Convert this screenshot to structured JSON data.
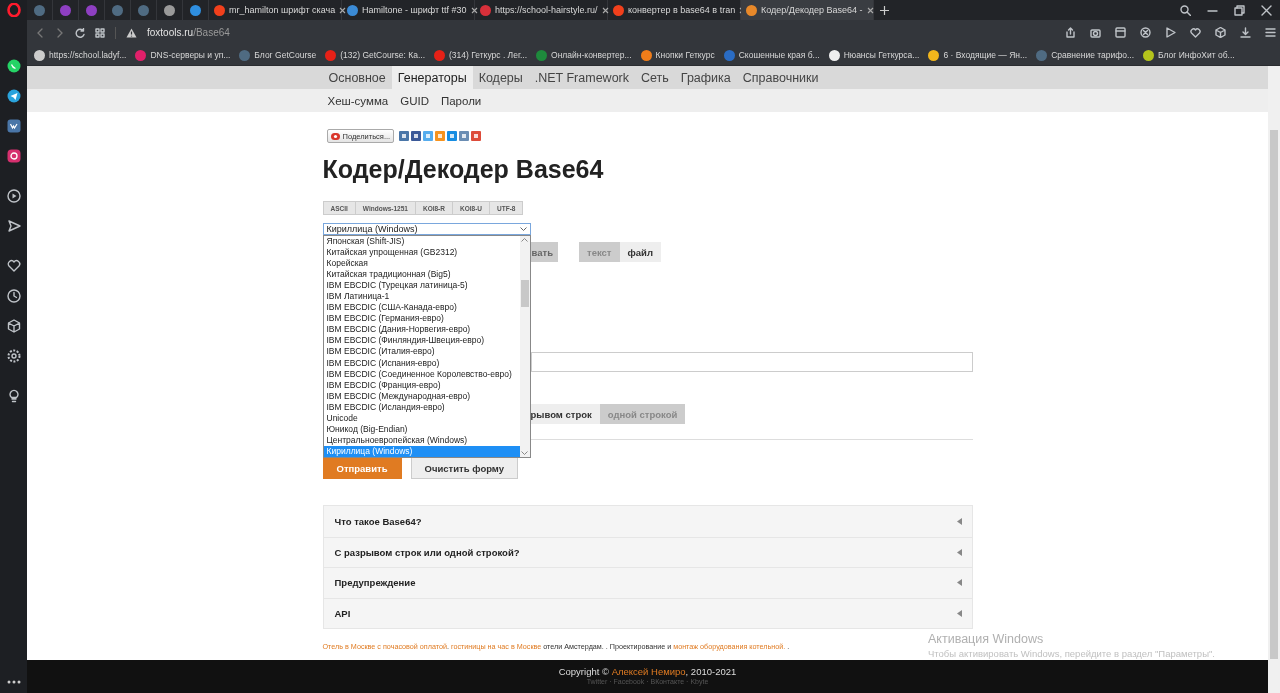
{
  "tabs": [
    {
      "selected": false,
      "color": "#4f6b82"
    },
    {
      "selected": false,
      "color": "#8e3fc2"
    },
    {
      "selected": false,
      "color": "#8e3fc2"
    },
    {
      "selected": false,
      "color": "#4f6b82"
    },
    {
      "selected": false,
      "color": "#4f6b82"
    },
    {
      "selected": false,
      "color": "#9a9a9a"
    },
    {
      "selected": false,
      "color": "#2f8fe0"
    },
    {
      "title": "mr_hamilton шрифт скача",
      "selected": false,
      "color": "#f2401c"
    },
    {
      "title": "Hamiltone - шрифт ttf #30",
      "selected": false,
      "color": "#3b8bd6"
    },
    {
      "title": "https://school-hairstyle.ru/",
      "selected": false,
      "color": "#d8303a"
    },
    {
      "title": "конвертер в base64 в tran",
      "selected": false,
      "color": "#f2401c"
    },
    {
      "title": "Кодер/Декодер Base64 -",
      "selected": true,
      "color": "#e8892a"
    }
  ],
  "address_bar": {
    "domain": "foxtools.ru",
    "path": "/Base64"
  },
  "bookmarks": [
    {
      "label": "https://school.ladyf...",
      "color": "#cccccc"
    },
    {
      "label": "DNS-серверы и уп...",
      "color": "#e0206a"
    },
    {
      "label": "Блог GetCourse",
      "color": "#4f6b82"
    },
    {
      "label": "(132) GetCourse: Ка...",
      "color": "#e62117"
    },
    {
      "label": "(314) Геткурс . Лег...",
      "color": "#e62117"
    },
    {
      "label": "Онлайн-конвертер...",
      "color": "#1e8a3c"
    },
    {
      "label": "Кнопки Геткурс",
      "color": "#f07d1a"
    },
    {
      "label": "Скошенные края б...",
      "color": "#2a6cc4"
    },
    {
      "label": "Нюансы Геткурса...",
      "color": "#eeeeee"
    },
    {
      "label": "6 · Входящие — Ян...",
      "color": "#f2b61c"
    },
    {
      "label": "Сравнение тарифо...",
      "color": "#4f6b82"
    },
    {
      "label": "Блог ИнфоХит об...",
      "color": "#b5c41c"
    }
  ],
  "site_nav": [
    {
      "label": "Основное",
      "selected": false
    },
    {
      "label": "Генераторы",
      "selected": true
    },
    {
      "label": "Кодеры",
      "selected": false
    },
    {
      "label": ".NET Framework",
      "selected": false
    },
    {
      "label": "Сеть",
      "selected": false
    },
    {
      "label": "Графика",
      "selected": false
    },
    {
      "label": "Справочники",
      "selected": false
    }
  ],
  "sub_nav": [
    "Хеш-сумма",
    "GUID",
    "Пароли"
  ],
  "share_button": "Поделиться...",
  "title": "Кодер/Декодер Base64",
  "encoding_presets": [
    "ASCII",
    "Windows-1251",
    "KOI8-R",
    "KOI8-U",
    "UTF-8"
  ],
  "encoding_select": {
    "value": "Кириллица (Windows)",
    "expanded": true,
    "options": [
      {
        "label": "Японская (Shift-JIS)",
        "selected": false
      },
      {
        "label": "Китайская упрощенная (GB2312)",
        "selected": false
      },
      {
        "label": "Корейская",
        "selected": false
      },
      {
        "label": "Китайская традиционная (Big5)",
        "selected": false
      },
      {
        "label": "IBM EBCDIC (Турецкая латиница-5)",
        "selected": false
      },
      {
        "label": "IBM Латиница-1",
        "selected": false
      },
      {
        "label": "IBM EBCDIC (США-Канада-евро)",
        "selected": false
      },
      {
        "label": "IBM EBCDIC (Германия-евро)",
        "selected": false
      },
      {
        "label": "IBM EBCDIC (Дания-Норвегия-евро)",
        "selected": false
      },
      {
        "label": "IBM EBCDIC (Финляндия-Швеция-евро)",
        "selected": false
      },
      {
        "label": "IBM EBCDIC (Италия-евро)",
        "selected": false
      },
      {
        "label": "IBM EBCDIC (Испания-евро)",
        "selected": false
      },
      {
        "label": "IBM EBCDIC (Соединенное Королевство-евро)",
        "selected": false
      },
      {
        "label": "IBM EBCDIC (Франция-евро)",
        "selected": false
      },
      {
        "label": "IBM EBCDIC (Международная-евро)",
        "selected": false
      },
      {
        "label": "IBM EBCDIC (Исландия-евро)",
        "selected": false
      },
      {
        "label": "Unicode",
        "selected": false
      },
      {
        "label": "Юникод (Big-Endian)",
        "selected": false
      },
      {
        "label": "Центральноевропейская (Windows)",
        "selected": false
      },
      {
        "label": "Кириллица (Windows)",
        "selected": true
      }
    ]
  },
  "mode_toggle": [
    {
      "label": "вать",
      "selected": false
    }
  ],
  "source_toggle": [
    {
      "label": "текст",
      "selected": false
    },
    {
      "label": "файл",
      "selected": true
    }
  ],
  "line_toggle": [
    {
      "label": "рывом строк",
      "selected": true
    },
    {
      "label": "одной строкой",
      "selected": false
    }
  ],
  "buttons": [
    {
      "label": "Отправить",
      "kind": "primary"
    },
    {
      "label": "Очистить форму",
      "kind": "secondary"
    }
  ],
  "faq": [
    {
      "title": "Что такое Base64?",
      "expanded": false
    },
    {
      "title": "С разрывом строк или одной строкой?",
      "expanded": false
    },
    {
      "title": "Предупреждение",
      "expanded": false
    },
    {
      "title": "API",
      "expanded": false
    }
  ],
  "ad_links": [
    {
      "text": "Отель в Москве с почасовой оплатой",
      "kind": "link"
    },
    {
      "text": ". ",
      "kind": "text"
    },
    {
      "text": "гостиницы на час в Москве",
      "kind": "link"
    },
    {
      "text": " отели Амстердам. . Проектирование и ",
      "kind": "text"
    },
    {
      "text": "монтаж оборудования котельной.",
      "kind": "link"
    },
    {
      "text": " .",
      "kind": "text"
    }
  ],
  "footer": {
    "copyright": "Copyright © ",
    "author": "Алексей Немиро",
    "years": ", 2010-2021",
    "links": "Twitter · Facebook · ВКонтакте · Kbyte"
  },
  "os_notice": {
    "title": "Активация Windows",
    "text": "Чтобы активировать Windows, перейдите в раздел \"Параметры\"."
  }
}
